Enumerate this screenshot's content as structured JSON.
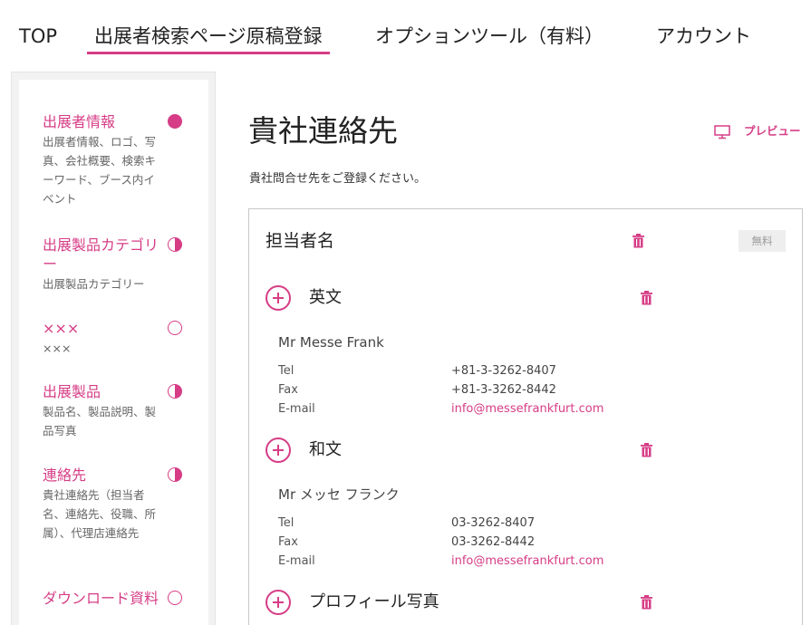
{
  "nav": {
    "tabs": [
      {
        "label": "TOP"
      },
      {
        "label": "出展者検索ページ原稿登録"
      },
      {
        "label": "オプションツール（有料）"
      },
      {
        "label": "アカウント"
      }
    ]
  },
  "sidebar": {
    "items": [
      {
        "title": "出展者情報",
        "desc": "出展者情報、ロゴ、写真、会社概要、検索キーワード、ブース内イベント",
        "status": "full"
      },
      {
        "title": "出展製品カテゴリー",
        "desc": "出展製品カテゴリー",
        "status": "half"
      },
      {
        "title": "×××",
        "desc": "×××",
        "status": "empty"
      },
      {
        "title": "出展製品",
        "desc": "製品名、製品説明、製品写真",
        "status": "half"
      },
      {
        "title": "連絡先",
        "desc": "貴社連絡先（担当者名、連絡先、役職、所属）、代理店連絡先",
        "status": "half"
      },
      {
        "title": "ダウンロード資料",
        "desc": "",
        "status": "empty"
      }
    ]
  },
  "main": {
    "title": "貴社連絡先",
    "preview_label": "プレビュー",
    "description": "貴社問合せ先をご登録ください。",
    "card": {
      "title": "担当者名",
      "badge": "無料",
      "sections": [
        {
          "title": "英文",
          "name": "Mr Messe Frank",
          "rows": [
            {
              "label": "Tel",
              "value": "+81-3-3262-8407"
            },
            {
              "label": "Fax",
              "value": "+81-3-3262-8442"
            },
            {
              "label": "E-mail",
              "value": "info@messefrankfurt.com"
            }
          ]
        },
        {
          "title": "和文",
          "name": "Mr メッセ フランク",
          "rows": [
            {
              "label": "Tel",
              "value": "03-3262-8407"
            },
            {
              "label": "Fax",
              "value": "03-3262-8442"
            },
            {
              "label": "E-mail",
              "value": "info@messefrankfurt.com"
            }
          ]
        },
        {
          "title": "プロフィール写真"
        }
      ]
    }
  },
  "colors": {
    "accent": "#d63d86",
    "text": "#222222",
    "muted": "#666666",
    "border": "#c8c8c8"
  },
  "icons": [
    "monitor-icon",
    "trash-icon",
    "plus-circle-icon",
    "status-dot-icon"
  ]
}
